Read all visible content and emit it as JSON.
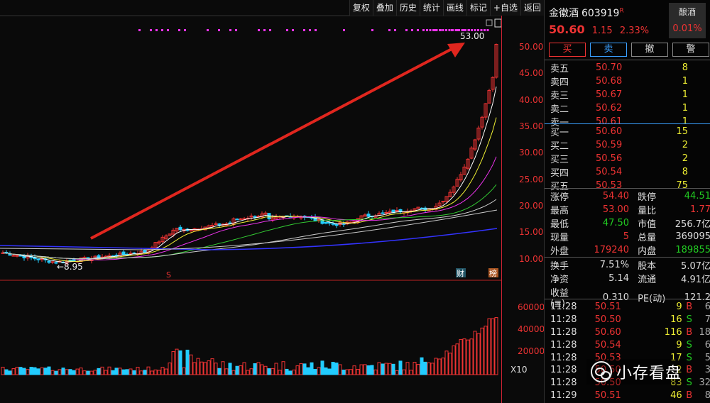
{
  "toolbar": {
    "items": [
      "复权",
      "叠加",
      "历史",
      "统计",
      "画线",
      "标记",
      "+自选",
      "返回"
    ]
  },
  "chart": {
    "high_label": "53.00",
    "low_label": "←8.95",
    "price_axis": [
      "50.00",
      "45.00",
      "40.00",
      "35.00",
      "30.00",
      "25.00",
      "20.00",
      "15.00",
      "10.00"
    ],
    "volume_axis": [
      "60000",
      "40000",
      "20000"
    ],
    "volume_unit": "X10",
    "marker_s": "S",
    "marker_cai": "财",
    "marker_bang": "榜",
    "colors": {
      "up": "#e33",
      "down": "#2cf",
      "ma5": "#fff",
      "ma10": "#ee3",
      "ma20": "#e3e",
      "ma60": "#3c3",
      "ma120": "#ccc",
      "ma250": "#33f",
      "arrow": "#e0261e"
    }
  },
  "quote": {
    "name": "金徽酒",
    "code": "603919",
    "tag": "R",
    "price": "50.60",
    "change": "1.15",
    "change_pct": "2.33%",
    "concept": {
      "name": "酿酒",
      "pct": "0.01%"
    }
  },
  "trade": {
    "buy": "买",
    "sell": "卖",
    "cancel": "撤",
    "alert": "警"
  },
  "asks": [
    {
      "label": "卖五",
      "price": "50.70",
      "vol": "8"
    },
    {
      "label": "卖四",
      "price": "50.68",
      "vol": "1"
    },
    {
      "label": "卖三",
      "price": "50.67",
      "vol": "1"
    },
    {
      "label": "卖二",
      "price": "50.62",
      "vol": "1"
    },
    {
      "label": "卖一",
      "price": "50.61",
      "vol": "1"
    }
  ],
  "bids": [
    {
      "label": "买一",
      "price": "50.60",
      "vol": "15"
    },
    {
      "label": "买二",
      "price": "50.59",
      "vol": "2"
    },
    {
      "label": "买三",
      "price": "50.56",
      "vol": "2"
    },
    {
      "label": "买四",
      "price": "50.54",
      "vol": "8"
    },
    {
      "label": "买五",
      "price": "50.53",
      "vol": "75"
    }
  ],
  "stats1": [
    {
      "k": "涨停",
      "v": "54.40",
      "vc": "red",
      "k2": "跌停",
      "v2": "44.51",
      "v2c": "green"
    },
    {
      "k": "最高",
      "v": "53.00",
      "vc": "red",
      "k2": "量比",
      "v2": "1.77",
      "v2c": "red"
    },
    {
      "k": "最低",
      "v": "47.50",
      "vc": "green",
      "k2": "市值",
      "v2": "256.7亿",
      "v2c": ""
    },
    {
      "k": "现量",
      "v": "5",
      "vc": "red",
      "k2": "总量",
      "v2": "369095",
      "v2c": ""
    },
    {
      "k": "外盘",
      "v": "179240",
      "vc": "red",
      "k2": "内盘",
      "v2": "189855",
      "v2c": "green"
    }
  ],
  "stats2": [
    {
      "k": "换手",
      "v": "7.51%",
      "k2": "股本",
      "v2": "5.07亿"
    },
    {
      "k": "净资",
      "v": "5.14",
      "k2": "流通",
      "v2": "4.91亿"
    },
    {
      "k": "收益(≣)",
      "v": "0.310",
      "k2": "PE(动)",
      "v2": "121.2"
    }
  ],
  "ticks": [
    {
      "t": "11:28",
      "p": "50.51",
      "v": "9",
      "bs": "B",
      "n": "6"
    },
    {
      "t": "11:28",
      "p": "50.50",
      "v": "16",
      "bs": "S",
      "n": "7"
    },
    {
      "t": "11:28",
      "p": "50.60",
      "v": "116",
      "bs": "B",
      "n": "18"
    },
    {
      "t": "11:28",
      "p": "50.54",
      "v": "9",
      "bs": "S",
      "n": "6"
    },
    {
      "t": "11:28",
      "p": "50.53",
      "v": "17",
      "bs": "S",
      "n": "5"
    },
    {
      "t": "11:28",
      "p": "50.50",
      "v": "2",
      "bs": "B",
      "n": "3"
    },
    {
      "t": "11:28",
      "p": "50.50",
      "v": "83",
      "bs": "S",
      "n": "32"
    },
    {
      "t": "11:29",
      "p": "50.51",
      "v": "46",
      "bs": "B",
      "n": "8"
    }
  ],
  "watermark": "小存看盘"
}
